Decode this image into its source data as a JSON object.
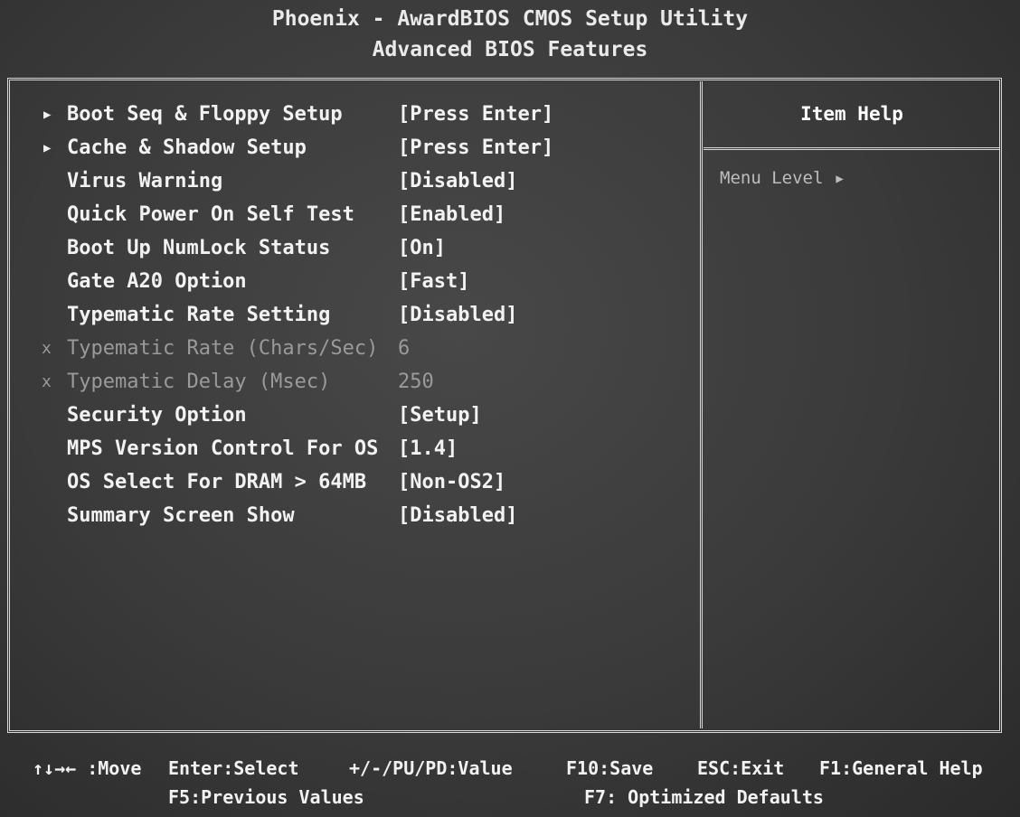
{
  "header": {
    "title": "Phoenix - AwardBIOS CMOS Setup Utility",
    "subtitle": "Advanced BIOS Features"
  },
  "settings": [
    {
      "label": "Boot Seq & Floppy Setup",
      "value": "[Press Enter]",
      "submenu": true,
      "disabled": false
    },
    {
      "label": "Cache & Shadow Setup",
      "value": "[Press Enter]",
      "submenu": true,
      "disabled": false
    },
    {
      "label": "Virus Warning",
      "value": "[Disabled]",
      "submenu": false,
      "disabled": false
    },
    {
      "label": "Quick Power On Self Test",
      "value": "[Enabled]",
      "submenu": false,
      "disabled": false
    },
    {
      "label": "Boot Up NumLock Status",
      "value": "[On]",
      "submenu": false,
      "disabled": false
    },
    {
      "label": "Gate A20 Option",
      "value": "[Fast]",
      "submenu": false,
      "disabled": false
    },
    {
      "label": "Typematic Rate Setting",
      "value": "[Disabled]",
      "submenu": false,
      "disabled": false
    },
    {
      "label": "Typematic Rate (Chars/Sec)",
      "value": "6",
      "submenu": false,
      "disabled": true
    },
    {
      "label": "Typematic Delay (Msec)",
      "value": "250",
      "submenu": false,
      "disabled": true
    },
    {
      "label": "Security Option",
      "value": "[Setup]",
      "submenu": false,
      "disabled": false
    },
    {
      "label": "MPS Version Control For OS",
      "value": "[1.4]",
      "submenu": false,
      "disabled": false
    },
    {
      "label": "OS Select For DRAM > 64MB",
      "value": "[Non-OS2]",
      "submenu": false,
      "disabled": false
    },
    {
      "label": "Summary Screen Show",
      "value": "[Disabled]",
      "submenu": false,
      "disabled": false
    }
  ],
  "help": {
    "title": "Item Help",
    "menu_level": "Menu Level"
  },
  "marks": {
    "submenu": "▶",
    "disabled": "x"
  },
  "footer": {
    "move": "↑↓→← :Move",
    "select": "Enter:Select",
    "value": "+/-/PU/PD:Value",
    "save": "F10:Save",
    "exit": "ESC:Exit",
    "general_help": "F1:General Help",
    "previous": "F5:Previous Values",
    "optimized": "F7: Optimized Defaults"
  }
}
